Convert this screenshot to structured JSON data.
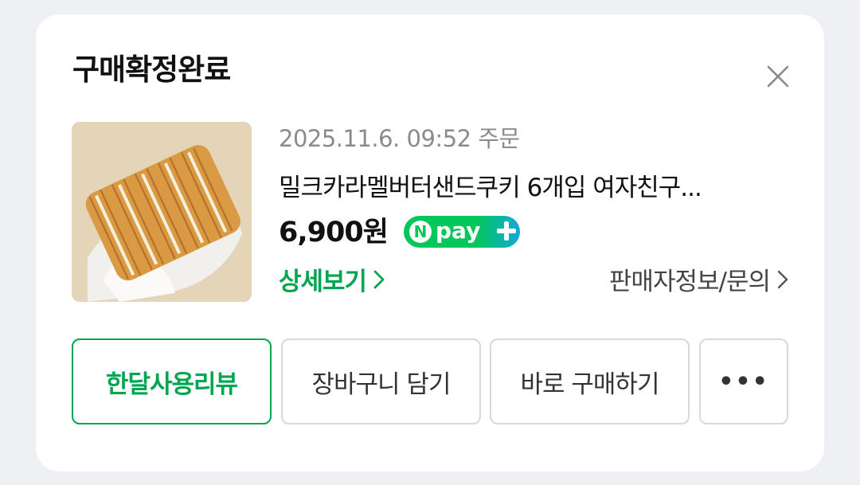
{
  "card": {
    "title": "구매확정완료",
    "close_icon": "close-icon"
  },
  "order": {
    "date": "2025.11.6. 09:52 주문",
    "product_name": "밀크카라멜버터샌드쿠키 6개입 여자친구...",
    "price": "6,900원",
    "npay_badge": {
      "letter": "N",
      "text": "pay",
      "icon": "plus-icon"
    },
    "detail_label": "상세보기",
    "seller_label": "판매자정보/문의"
  },
  "buttons": {
    "review": "한달사용리뷰",
    "cart": "장바구니 담기",
    "buy": "바로 구매하기",
    "more": "•••"
  },
  "colors": {
    "accent_green": "#03a550",
    "npay_green": "#03c75a",
    "npay_blue": "#11a8d9",
    "background": "#eef0f3",
    "card": "#ffffff"
  }
}
